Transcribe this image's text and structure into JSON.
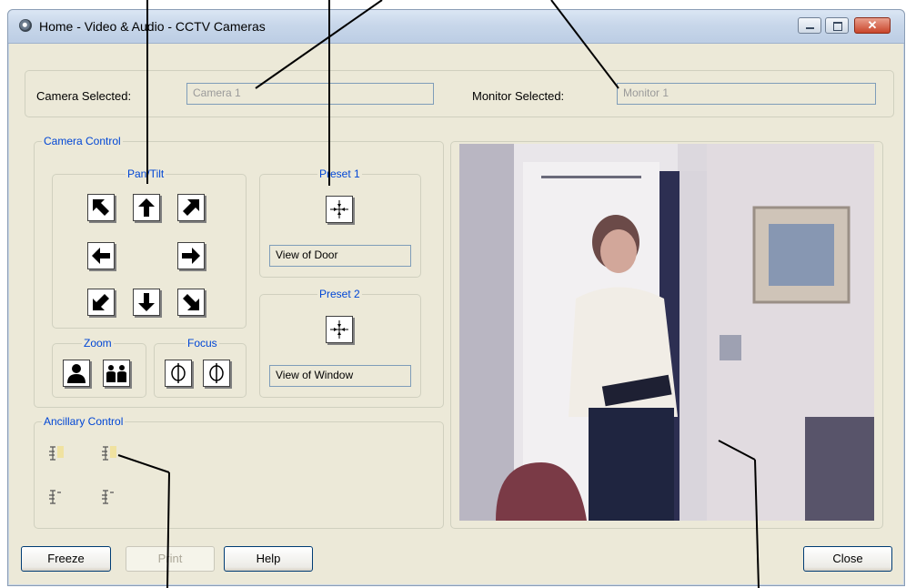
{
  "window": {
    "title": "Home - Video & Audio - CCTV Cameras"
  },
  "selection": {
    "camera_label": "Camera Selected:",
    "camera_value": "Camera 1",
    "monitor_label": "Monitor Selected:",
    "monitor_value": "Monitor 1"
  },
  "camera_control": {
    "title": "Camera Control",
    "pan_tilt_title": "Pan/Tilt",
    "zoom_title": "Zoom",
    "focus_title": "Focus",
    "presets": [
      {
        "title": "Preset 1",
        "name": "View of Door"
      },
      {
        "title": "Preset 2",
        "name": "View of Window"
      }
    ]
  },
  "ancillary": {
    "title": "Ancillary Control",
    "icons": [
      "relay-on-icon",
      "relay-on-icon",
      "relay-off-icon",
      "relay-off-icon"
    ]
  },
  "video": {
    "description_icon": "camera-feed"
  },
  "buttons": {
    "freeze": "Freeze",
    "print": "Print",
    "help": "Help",
    "close": "Close"
  },
  "icons": {
    "preset": "preset-goto-icon",
    "zoom_in": "zoom-single-person-icon",
    "zoom_out": "zoom-two-people-icon",
    "focus_near": "focus-near-icon",
    "focus_far": "focus-far-icon"
  },
  "colors": {
    "group_title": "#0046d5",
    "window_bg": "#ece9d8"
  }
}
